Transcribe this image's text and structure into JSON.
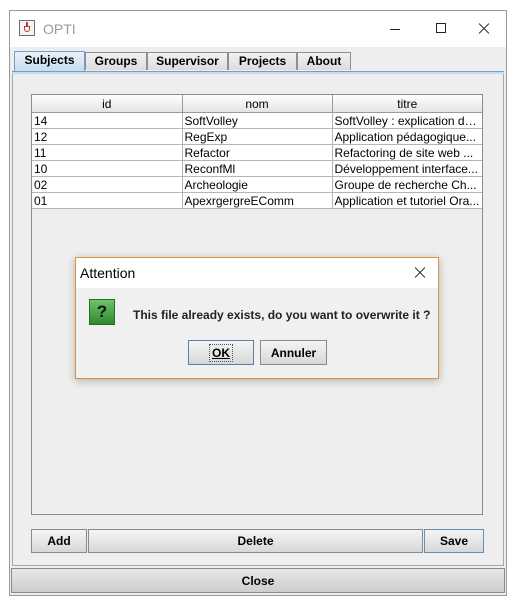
{
  "window": {
    "title": "OPTI"
  },
  "tabs": [
    {
      "label": "Subjects",
      "active": true
    },
    {
      "label": "Groups",
      "active": false
    },
    {
      "label": "Supervisor",
      "active": false
    },
    {
      "label": "Projects",
      "active": false
    },
    {
      "label": "About",
      "active": false
    }
  ],
  "table": {
    "columns": [
      "id",
      "nom",
      "titre"
    ],
    "rows": [
      [
        "14",
        "SoftVolley",
        "SoftVolley : explication de..."
      ],
      [
        "12",
        "RegExp",
        "Application pédagogique..."
      ],
      [
        "11",
        "Refactor",
        "Refactoring de site web ..."
      ],
      [
        "10",
        "ReconfMl",
        "Développement interface..."
      ],
      [
        "02",
        "Archeologie",
        "Groupe de recherche Ch..."
      ],
      [
        "01",
        "ApexrgergreEComm",
        "Application et tutoriel Ora..."
      ]
    ]
  },
  "buttons": {
    "add": "Add",
    "delete": "Delete",
    "save": "Save",
    "close": "Close"
  },
  "dialog": {
    "title": "Attention",
    "icon": "question-icon",
    "message": "This file already exists, do you want to overwrite it  ?",
    "ok": "OK",
    "cancel": "Annuler"
  },
  "colors": {
    "active_tab": "#c4dbf0",
    "dialog_border": "#e0913b",
    "question_icon": "#3e9e3a"
  }
}
